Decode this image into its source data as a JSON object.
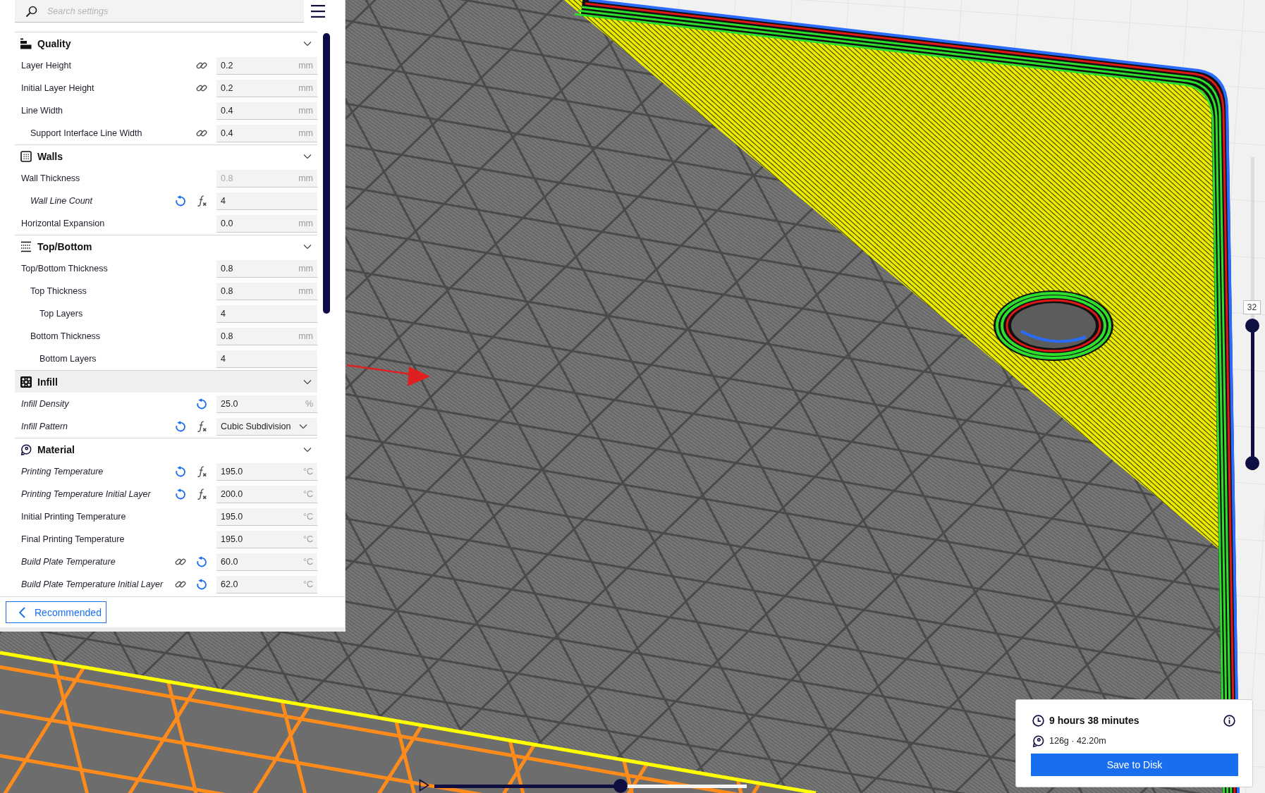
{
  "search": {
    "placeholder": "Search settings"
  },
  "sections": [
    {
      "title": "Quality",
      "kind": "quality",
      "expanded": true,
      "highlighted": false,
      "settings": [
        {
          "label": "Layer Height",
          "modified": false,
          "icons": [
            {
              "kind": "link"
            }
          ],
          "field": {
            "kind": "number",
            "value": "0.2",
            "unit": "mm",
            "disabled": false
          }
        },
        {
          "label": "Initial Layer Height",
          "modified": false,
          "icons": [
            {
              "kind": "link"
            }
          ],
          "field": {
            "kind": "number",
            "value": "0.2",
            "unit": "mm",
            "disabled": false
          }
        },
        {
          "label": "Line Width",
          "modified": false,
          "field": {
            "kind": "number",
            "value": "0.4",
            "unit": "mm",
            "disabled": false
          },
          "children": [
            {
              "label": "Support Interface Line Width",
              "modified": false,
              "icons": [
                {
                  "kind": "link"
                }
              ],
              "field": {
                "kind": "number",
                "value": "0.4",
                "unit": "mm",
                "disabled": false
              }
            }
          ]
        }
      ]
    },
    {
      "title": "Walls",
      "kind": "walls",
      "expanded": true,
      "highlighted": false,
      "settings": [
        {
          "label": "Wall Thickness",
          "modified": false,
          "field": {
            "kind": "number",
            "value": "0.8",
            "unit": "mm",
            "disabled": true
          },
          "children": [
            {
              "label": "Wall Line Count",
              "modified": true,
              "icons": [
                {
                  "kind": "reset"
                },
                {
                  "kind": "function"
                }
              ],
              "field": {
                "kind": "number",
                "value": "4",
                "disabled": false
              }
            }
          ]
        },
        {
          "label": "Horizontal Expansion",
          "modified": false,
          "field": {
            "kind": "number",
            "value": "0.0",
            "unit": "mm",
            "disabled": false
          }
        }
      ]
    },
    {
      "title": "Top/Bottom",
      "kind": "topbottom",
      "expanded": true,
      "highlighted": false,
      "settings": [
        {
          "label": "Top/Bottom Thickness",
          "modified": false,
          "field": {
            "kind": "number",
            "value": "0.8",
            "unit": "mm",
            "disabled": false
          },
          "children": [
            {
              "label": "Top Thickness",
              "modified": false,
              "field": {
                "kind": "number",
                "value": "0.8",
                "unit": "mm",
                "disabled": false
              },
              "children": [
                {
                  "label": "Top Layers",
                  "modified": false,
                  "field": {
                    "kind": "number",
                    "value": "4",
                    "disabled": false
                  }
                }
              ]
            },
            {
              "label": "Bottom Thickness",
              "modified": false,
              "field": {
                "kind": "number",
                "value": "0.8",
                "unit": "mm",
                "disabled": false
              },
              "children": [
                {
                  "label": "Bottom Layers",
                  "modified": false,
                  "field": {
                    "kind": "number",
                    "value": "4",
                    "disabled": false
                  }
                }
              ]
            }
          ]
        }
      ]
    },
    {
      "title": "Infill",
      "kind": "infill",
      "expanded": true,
      "highlighted": true,
      "settings": [
        {
          "label": "Infill Density",
          "modified": true,
          "icons": [
            {
              "kind": "reset"
            }
          ],
          "field": {
            "kind": "number",
            "value": "25.0",
            "unit": "%",
            "disabled": false
          }
        },
        {
          "label": "Infill Pattern",
          "modified": true,
          "icons": [
            {
              "kind": "reset"
            },
            {
              "kind": "function"
            }
          ],
          "field": {
            "kind": "dropdown",
            "value": "Cubic Subdivision",
            "disabled": false
          }
        }
      ]
    },
    {
      "title": "Material",
      "kind": "material",
      "expanded": true,
      "highlighted": false,
      "settings": [
        {
          "label": "Printing Temperature",
          "modified": true,
          "icons": [
            {
              "kind": "reset"
            },
            {
              "kind": "function"
            }
          ],
          "field": {
            "kind": "number",
            "value": "195.0",
            "unit": "°C",
            "disabled": false
          }
        },
        {
          "label": "Printing Temperature Initial Layer",
          "modified": true,
          "icons": [
            {
              "kind": "reset"
            },
            {
              "kind": "function"
            }
          ],
          "field": {
            "kind": "number",
            "value": "200.0",
            "unit": "°C",
            "disabled": false
          }
        },
        {
          "label": "Initial Printing Temperature",
          "modified": false,
          "field": {
            "kind": "number",
            "value": "195.0",
            "unit": "°C",
            "disabled": false
          }
        },
        {
          "label": "Final Printing Temperature",
          "modified": false,
          "field": {
            "kind": "number",
            "value": "195.0",
            "unit": "°C",
            "disabled": false
          }
        },
        {
          "label": "Build Plate Temperature",
          "modified": true,
          "icons": [
            {
              "kind": "link"
            },
            {
              "kind": "reset"
            }
          ],
          "field": {
            "kind": "number",
            "value": "60.0",
            "unit": "°C",
            "disabled": false
          }
        },
        {
          "label": "Build Plate Temperature Initial Layer",
          "modified": true,
          "icons": [
            {
              "kind": "link"
            },
            {
              "kind": "reset"
            }
          ],
          "field": {
            "kind": "number",
            "value": "62.0",
            "unit": "°C",
            "disabled": false
          }
        }
      ]
    }
  ],
  "footer": {
    "button": "Recommended"
  },
  "layer_slider": {
    "handles": [
      {
        "label": "32",
        "level": 0.46
      },
      {
        "level": 0
      }
    ]
  },
  "playback": {
    "level": 0.6
  },
  "print_info": {
    "time": "9 hours 38 minutes",
    "material": "126g · 42.20m",
    "button": "Save to Disk"
  }
}
